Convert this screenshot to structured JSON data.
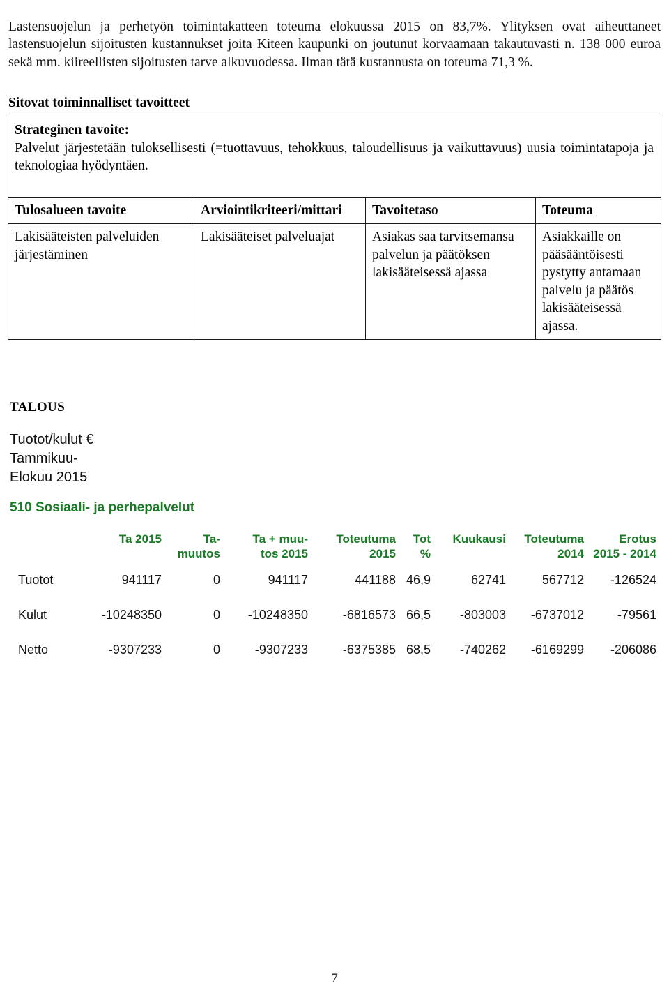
{
  "intro": {
    "paragraph": "Lastensuojelun ja perhetyön toimintakatteen toteuma elokuussa 2015 on 83,7%. Ylityksen ovat aiheuttaneet lastensuojelun sijoitusten kustannukset joita Kiteen kaupunki on joutunut korvaamaan takautuvasti n. 138 000 euroa sekä mm. kiireellisten sijoitusten tarve alkuvuodessa. Ilman tätä kustannusta on toteuma 71,3 %."
  },
  "section": {
    "heading": "Sitovat toiminnalliset tavoitteet"
  },
  "goals": {
    "strategic": {
      "title": "Strateginen tavoite:",
      "body": "Palvelut järjestetään tuloksellisesti (=tuottavuus, tehokkuus, taloudellisuus ja vaikuttavuus) uusia toimintatapoja ja teknologiaa hyödyntäen."
    },
    "headers": [
      "Tulosalueen tavoite",
      "Arviointikriteeri/mittari",
      "Tavoitetaso",
      "Toteuma"
    ],
    "rows": [
      {
        "tavoite": "Lakisääteisten palveluiden järjestäminen",
        "mittari": "Lakisääteiset palveluajat",
        "tavoitetaso": "Asiakas saa tarvitsemansa palvelun ja päätöksen lakisääteisessä ajassa",
        "toteuma": "Asiakkaille on pääsääntöisesti pystytty antamaan palvelu ja päätös lakisääteisessä ajassa."
      }
    ]
  },
  "talous": {
    "heading": "TALOUS",
    "subtitle": "Tuotot/kulut €\nTammikuu-\nElokuu 2015",
    "table_title": "510 Sosiaali- ja perhepalvelut",
    "accent_color": "#1a7a26",
    "headers": [
      "",
      "Ta 2015",
      "Ta-\nmuutos",
      "Ta + muu-\ntos 2015",
      "Toteutuma\n2015",
      "Tot\n%",
      "Kuukausi",
      "Toteutuma\n2014",
      "Erotus\n2015 - 2014"
    ],
    "rows": [
      {
        "label": "Tuotot",
        "values": [
          "941117",
          "0",
          "941117",
          "441188",
          "46,9",
          "62741",
          "567712",
          "-126524"
        ]
      },
      {
        "label": "Kulut",
        "values": [
          "-10248350",
          "0",
          "-10248350",
          "-6816573",
          "66,5",
          "-803003",
          "-6737012",
          "-79561"
        ]
      },
      {
        "label": "Netto",
        "values": [
          "-9307233",
          "0",
          "-9307233",
          "-6375385",
          "68,5",
          "-740262",
          "-6169299",
          "-206086"
        ]
      }
    ]
  },
  "footer": {
    "page_number": "7"
  }
}
